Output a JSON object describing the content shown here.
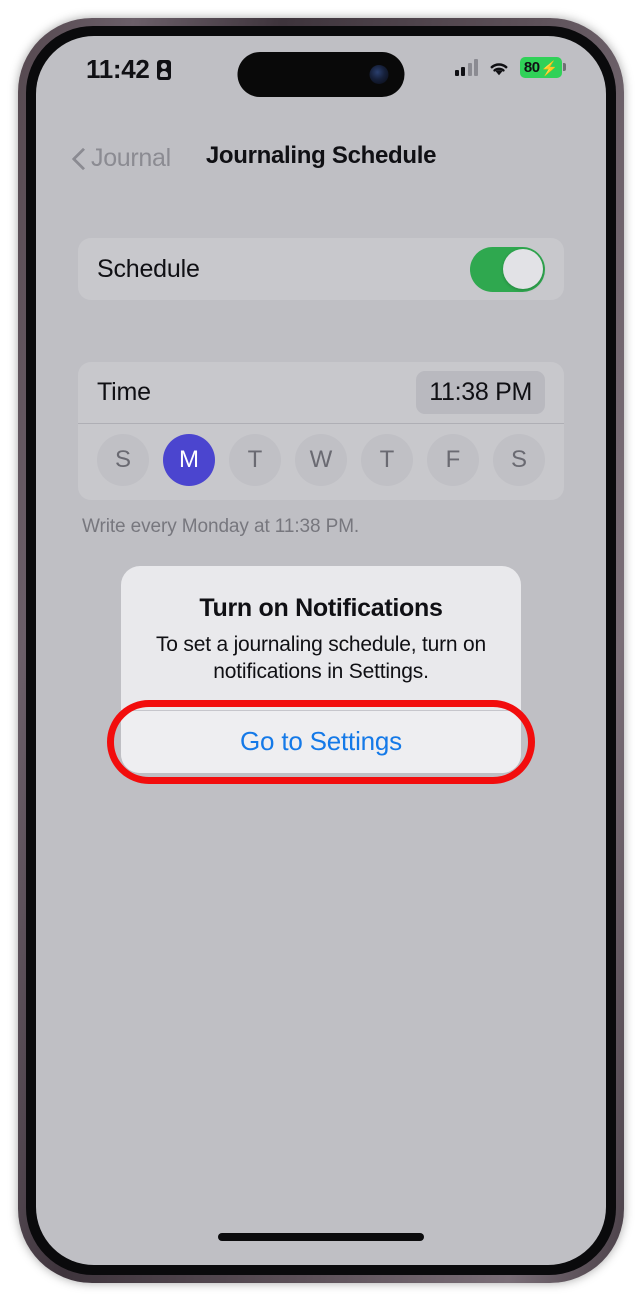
{
  "status_bar": {
    "time": "11:42",
    "badge_icon": "lock-badge-icon",
    "cellular_icon": "cellular-signal-icon",
    "wifi_icon": "wifi-icon",
    "battery_level": "80",
    "battery_charging_icon": "⚡",
    "battery_color": "#30d158"
  },
  "nav": {
    "back_label": "Journal",
    "back_icon": "chevron-left-icon",
    "title": "Journaling Schedule"
  },
  "schedule": {
    "label": "Schedule",
    "toggle_on": true,
    "toggle_color": "#2fa84f"
  },
  "time_section": {
    "label": "Time",
    "value": "11:38 PM",
    "weekdays": [
      {
        "letter": "S",
        "name": "Sunday",
        "selected": false
      },
      {
        "letter": "M",
        "name": "Monday",
        "selected": true
      },
      {
        "letter": "T",
        "name": "Tuesday",
        "selected": false
      },
      {
        "letter": "W",
        "name": "Wednesday",
        "selected": false
      },
      {
        "letter": "T",
        "name": "Thursday",
        "selected": false
      },
      {
        "letter": "F",
        "name": "Friday",
        "selected": false
      },
      {
        "letter": "S",
        "name": "Saturday",
        "selected": false
      }
    ],
    "selected_color": "#4b45cf",
    "footnote": "Write every Monday at 11:38 PM."
  },
  "alert": {
    "title": "Turn on Notifications",
    "message": "To set a journaling schedule, turn on notifications in Settings.",
    "action_label": "Go to Settings",
    "action_color": "#1479e8",
    "highlight_color": "#f20d0d"
  },
  "home_indicator": "home-indicator"
}
